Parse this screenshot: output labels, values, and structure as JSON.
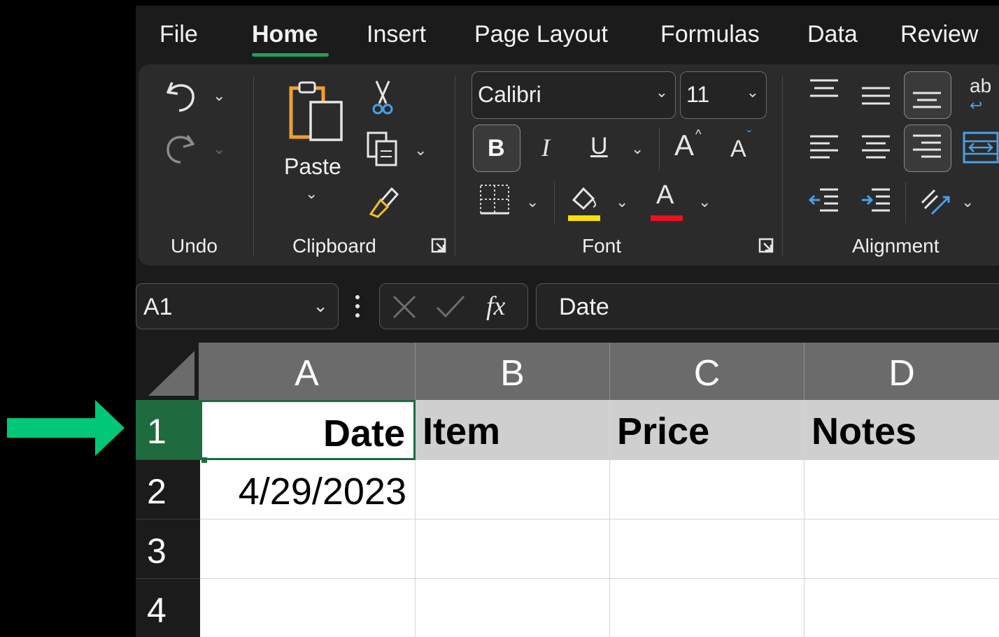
{
  "tabs": [
    "File",
    "Home",
    "Insert",
    "Page Layout",
    "Formulas",
    "Data",
    "Review"
  ],
  "ribbon": {
    "undo_label": "Undo",
    "clipboard_label": "Clipboard",
    "paste_label": "Paste",
    "font_label": "Font",
    "alignment_label": "Alignment",
    "font_name": "Calibri",
    "font_size": "11",
    "bold": "B",
    "italic": "I",
    "underline": "U",
    "grow_font": "A",
    "shrink_font": "A",
    "font_color_letter": "A",
    "wrap_text": "ab",
    "highlight_color": "#ffe000",
    "font_color": "#e81123"
  },
  "formula_bar": {
    "name_box": "A1",
    "fx": "fx",
    "content": "Date"
  },
  "grid": {
    "columns": [
      "A",
      "B",
      "C",
      "D"
    ],
    "rows": [
      "1",
      "2",
      "3",
      "4"
    ],
    "cells": {
      "r1": [
        "Date",
        "Item",
        "Price",
        "Notes"
      ],
      "r2": [
        "4/29/2023",
        "",
        "",
        ""
      ]
    }
  },
  "colors": {
    "accent_green": "#1e9e5a",
    "arrow_green": "#00c878",
    "selected_row": "#1e6b40"
  }
}
